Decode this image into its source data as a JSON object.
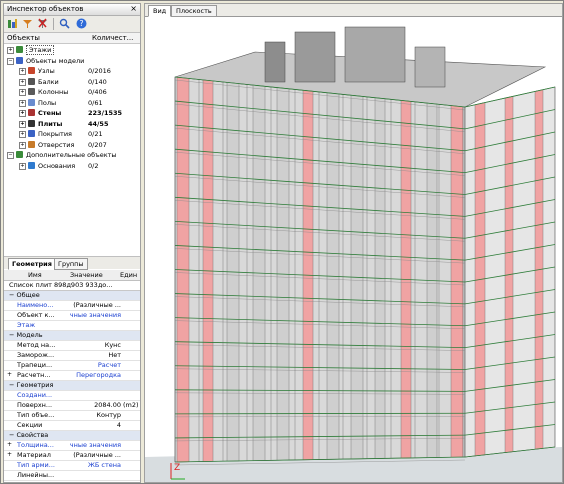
{
  "inspector": {
    "title": "Инспектор объектов",
    "close": "×",
    "columns": [
      "Объекты",
      "Количест..."
    ],
    "tree": [
      {
        "label": "Этажи",
        "count": "",
        "level": 0,
        "bold": false,
        "expander": "+"
      },
      {
        "label": "Объекты модели",
        "count": "",
        "level": 0,
        "bold": false,
        "expander": "−"
      },
      {
        "label": "Узлы",
        "count": "0/2016",
        "level": 1,
        "bold": false,
        "expander": "+"
      },
      {
        "label": "Балки",
        "count": "0/140",
        "level": 1,
        "bold": false,
        "expander": "+"
      },
      {
        "label": "Колонны",
        "count": "0/406",
        "level": 1,
        "bold": false,
        "expander": "+"
      },
      {
        "label": "Полы",
        "count": "0/61",
        "level": 1,
        "bold": false,
        "expander": "+"
      },
      {
        "label": "Стены",
        "count": "223/1535",
        "level": 1,
        "bold": true,
        "expander": "+"
      },
      {
        "label": "Плиты",
        "count": "44/55",
        "level": 1,
        "bold": true,
        "expander": "+"
      },
      {
        "label": "Покрытия",
        "count": "0/21",
        "level": 1,
        "bold": false,
        "expander": "+"
      },
      {
        "label": "Отверстия",
        "count": "0/207",
        "level": 1,
        "bold": false,
        "expander": "+"
      },
      {
        "label": "Дополнительные объекты",
        "count": "",
        "level": 0,
        "bold": false,
        "expander": "−"
      },
      {
        "label": "Основания",
        "count": "0/2",
        "level": 1,
        "bold": false,
        "expander": "+"
      }
    ],
    "tabs": [
      "Геометрия",
      "Группы"
    ],
    "props_header": [
      "Имя",
      "Значение",
      "Един"
    ],
    "selection": "Список плит  898д903 933до...",
    "rows": [
      {
        "type": "sec",
        "name": "Общее",
        "value": "",
        "unit": ""
      },
      {
        "type": "row",
        "name": "Наимено...",
        "value": "(Различные ...",
        "unit": "",
        "blueName": true,
        "blueVal": false
      },
      {
        "type": "row",
        "name": "Объект к...",
        "value": "чные значения",
        "unit": "",
        "blueName": false,
        "blueVal": true
      },
      {
        "type": "row",
        "name": "Этаж",
        "value": "",
        "unit": "",
        "blueName": true,
        "blueVal": false
      },
      {
        "type": "sec",
        "name": "Модель",
        "value": "",
        "unit": ""
      },
      {
        "type": "row",
        "name": "Метод на...",
        "value": "Кунс",
        "unit": "",
        "blueName": false,
        "blueVal": false
      },
      {
        "type": "row",
        "name": "Заморож...",
        "value": "Нет",
        "unit": "",
        "blueName": false,
        "blueVal": false
      },
      {
        "type": "row",
        "name": "Трапеци...",
        "value": "Расчет",
        "unit": "",
        "blueName": false,
        "blueVal": true
      },
      {
        "type": "row",
        "name": "Расчетн...",
        "value": "Перегородка",
        "unit": "",
        "blueName": false,
        "blueVal": true,
        "plus": true
      },
      {
        "type": "sec",
        "name": "Геометрия",
        "value": "",
        "unit": ""
      },
      {
        "type": "row",
        "name": "Создани...",
        "value": "",
        "unit": "",
        "blueName": true,
        "blueVal": false
      },
      {
        "type": "row",
        "name": "Поверхн...",
        "value": "2084.00",
        "unit": "(m2)",
        "blueName": false,
        "blueVal": false
      },
      {
        "type": "row",
        "name": "Тип объе...",
        "value": "Контур",
        "unit": "",
        "blueName": false,
        "blueVal": false
      },
      {
        "type": "row",
        "name": "Секции",
        "value": "4",
        "unit": "",
        "blueName": false,
        "blueVal": false
      },
      {
        "type": "sec",
        "name": "Свойства",
        "value": "",
        "unit": ""
      },
      {
        "type": "row",
        "name": "Толщина...",
        "value": "чные значения",
        "unit": "",
        "blueName": true,
        "blueVal": true,
        "plus": true
      },
      {
        "type": "row",
        "name": "Материал",
        "value": "(Различные ...",
        "unit": "",
        "blueName": false,
        "blueVal": false,
        "plus": true
      },
      {
        "type": "row",
        "name": "Тип арми...",
        "value": "ЖБ стена",
        "unit": "",
        "blueName": true,
        "blueVal": true
      },
      {
        "type": "row",
        "name": "Линейны...",
        "value": "",
        "unit": "",
        "blueName": false,
        "blueVal": false
      }
    ]
  },
  "viewport": {
    "tabs": [
      "Вид",
      "Плоскость"
    ],
    "axis_label": "Z",
    "floors": 16,
    "colors": {
      "wall_red": "#f0a3a3",
      "wall_gray": "#cfcfcf",
      "edge_green": "#2f7d3a",
      "slab": "#b9b9b9"
    }
  }
}
